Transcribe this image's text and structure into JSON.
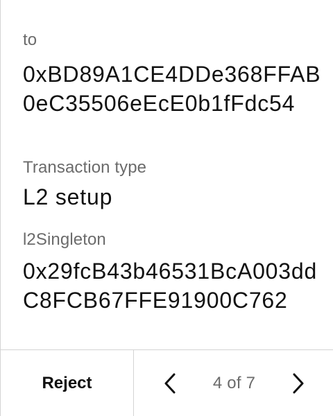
{
  "fields": {
    "to": {
      "label": "to",
      "value": "0xBD89A1CE4DDe368FFAB0eC35506eEcE0b1fFdc54"
    },
    "transaction_type": {
      "label": "Transaction type",
      "value": "L2 setup"
    },
    "l2_singleton": {
      "label": "l2Singleton",
      "value": "0x29fcB43b46531BcA003ddC8FCB67FFE91900C762"
    }
  },
  "footer": {
    "reject_label": "Reject",
    "page_indicator": "4 of 7",
    "prev_icon": "chevron-left-icon",
    "next_icon": "chevron-right-icon"
  }
}
